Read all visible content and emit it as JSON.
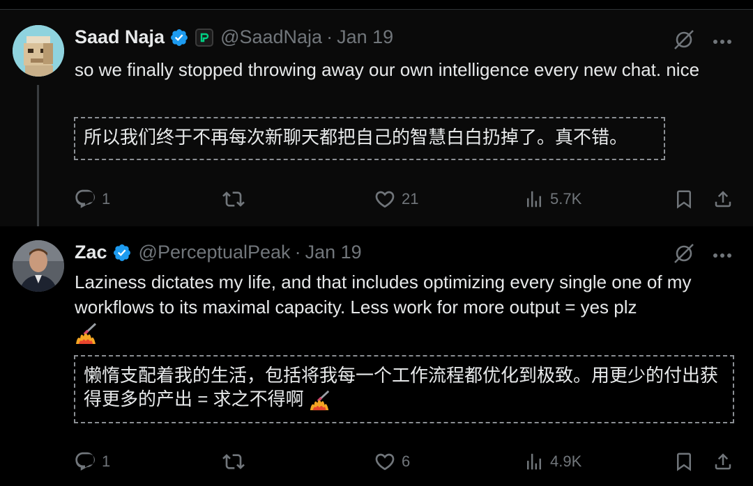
{
  "tweets": [
    {
      "name": "Saad Naja",
      "handle": "@SaadNaja",
      "separator": "·",
      "date": "Jan 19",
      "text": "so we finally stopped throwing away our own intelligence every new chat. nice",
      "translation": "所以我们终于不再每次新聊天都把自己的智慧白白扔掉了。真不错。",
      "stats": {
        "replies": "1",
        "retweets": "",
        "likes": "21",
        "views": "5.7K"
      }
    },
    {
      "name": "Zac",
      "handle": "@PerceptualPeak",
      "separator": "·",
      "date": "Jan 19",
      "text": "Laziness dictates my life, and that includes optimizing every single one of my workflows to its maximal capacity. Less work for more output = yes plz",
      "translation": "懒惰支配着我的生活，包括将我每一个工作流程都优化到极致。用更少的付出获得更多的产出 = 求之不得啊",
      "stats": {
        "replies": "1",
        "retweets": "",
        "likes": "6",
        "views": "4.9K"
      }
    }
  ],
  "icons": {
    "verified": "verified-badge-icon",
    "org": "org-badge-icon",
    "grok": "grok-icon",
    "more": "more-icon",
    "reply": "reply-icon",
    "retweet": "retweet-icon",
    "like": "heart-icon",
    "views": "views-icon",
    "bookmark": "bookmark-icon",
    "share": "share-icon",
    "emoji": "fire-syringe-emoji"
  },
  "colors": {
    "background": "#000000",
    "text": "#e7e9ea",
    "muted": "#71767b",
    "verified": "#1d9bf0",
    "org_badge_accent": "#00d084"
  }
}
